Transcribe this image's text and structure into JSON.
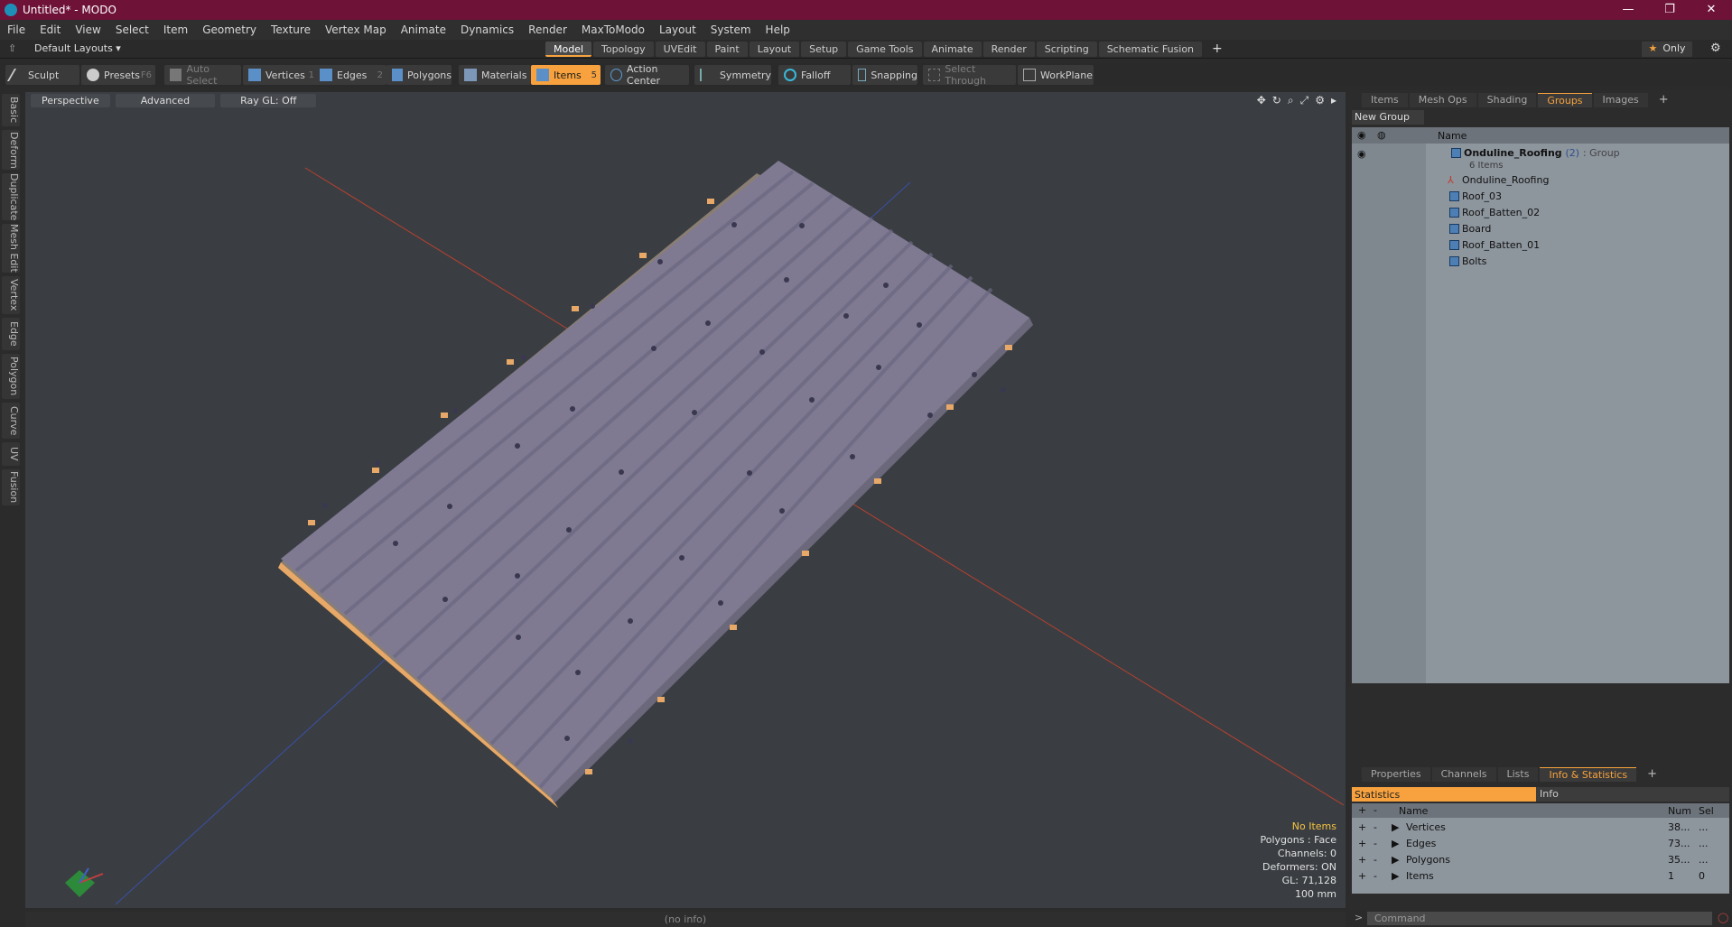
{
  "window": {
    "title": "Untitled* - MODO",
    "ctrl_min": "—",
    "ctrl_max": "❐",
    "ctrl_close": "✕"
  },
  "menu": [
    "File",
    "Edit",
    "View",
    "Select",
    "Item",
    "Geometry",
    "Texture",
    "Vertex Map",
    "Animate",
    "Dynamics",
    "Render",
    "MaxToModo",
    "Layout",
    "System",
    "Help"
  ],
  "layoutbar": {
    "default_layouts": "Default Layouts ▾",
    "tabs": [
      "Model",
      "Topology",
      "UVEdit",
      "Paint",
      "Layout",
      "Setup",
      "Game Tools",
      "Animate",
      "Render",
      "Scripting",
      "Schematic Fusion"
    ],
    "active_tab": "Model",
    "plus": "+",
    "only": "Only"
  },
  "toolbar": {
    "sculpt": "Sculpt",
    "presets": "Presets",
    "presets_key": "F6",
    "auto_select": "Auto Select",
    "vertices": "Vertices",
    "vertices_num": "1",
    "edges": "Edges",
    "edges_num": "2",
    "polygons": "Polygons",
    "materials": "Materials",
    "items": "Items",
    "items_num": "5",
    "action_center": "Action Center",
    "symmetry": "Symmetry",
    "falloff": "Falloff",
    "snapping": "Snapping",
    "select_through": "Select Through",
    "workplane": "WorkPlane"
  },
  "left_tabs": [
    "Basic",
    "Deform",
    "Duplicate",
    "Mesh Edit",
    "Vertex",
    "Edge",
    "Polygon",
    "Curve",
    "UV",
    "Fusion"
  ],
  "viewport": {
    "perspective": "Perspective",
    "advanced": "Advanced",
    "raygl": "Ray GL: Off",
    "info": {
      "no_items": "No Items",
      "polygons": "Polygons : Face",
      "channels": "Channels: 0",
      "deformers": "Deformers: ON",
      "gl": "GL: 71,128",
      "scale": "100 mm"
    },
    "status": "(no info)"
  },
  "right_panel": {
    "tabs": [
      "Items",
      "Mesh Ops",
      "Shading",
      "Groups",
      "Images"
    ],
    "active_tab": "Groups",
    "new_group": "New Group",
    "col_name": "Name",
    "group": {
      "name": "Onduline_Roofing",
      "count": "(2)",
      "type": ": Group",
      "subcount": "6 Items"
    },
    "items": [
      "Onduline_Roofing",
      "Roof_03",
      "Roof_Batten_02",
      "Board",
      "Roof_Batten_01",
      "Bolts"
    ],
    "bottom_tabs": [
      "Properties",
      "Channels",
      "Lists",
      "Info & Statistics"
    ],
    "bottom_active": "Info & Statistics",
    "stats_label": "Statistics",
    "info_label": "Info",
    "stat_cols": {
      "name": "Name",
      "num": "Num",
      "sel": "Sel"
    },
    "stat_rows": [
      {
        "name": "Vertices",
        "num": "38...",
        "sel": "..."
      },
      {
        "name": "Edges",
        "num": "73...",
        "sel": "..."
      },
      {
        "name": "Polygons",
        "num": "35...",
        "sel": "..."
      },
      {
        "name": "Items",
        "num": "1",
        "sel": "0"
      }
    ],
    "command": "Command"
  },
  "colors": {
    "title_bg": "#6e1238",
    "accent": "#f7a23e",
    "viewport_bg": "#3a3e42",
    "roof": "#7f7a92",
    "batten": "#e7a868"
  }
}
